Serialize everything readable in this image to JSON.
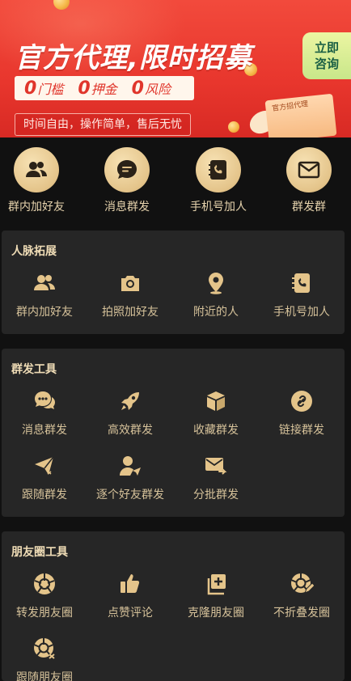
{
  "banner": {
    "title": "官方代理,限时招募",
    "tags": [
      {
        "num": "0",
        "text": "门槛"
      },
      {
        "num": "0",
        "text": "押金"
      },
      {
        "num": "0",
        "text": "风险"
      }
    ],
    "slogan": "时间自由，操作简单，售后无忧",
    "consult_line1": "立即",
    "consult_line2": "咨询",
    "box_label": "官方招代理"
  },
  "quick": [
    {
      "label": "群内加好友",
      "icon": "group-users-icon"
    },
    {
      "label": "消息群发",
      "icon": "message-bubble-icon"
    },
    {
      "label": "手机号加人",
      "icon": "phone-book-icon"
    },
    {
      "label": "群发群",
      "icon": "envelope-icon"
    }
  ],
  "sections": {
    "network": {
      "title": "人脉拓展",
      "items": [
        {
          "label": "群内加好友",
          "icon": "group-users-icon"
        },
        {
          "label": "拍照加好友",
          "icon": "camera-icon"
        },
        {
          "label": "附近的人",
          "icon": "location-pin-icon"
        },
        {
          "label": "手机号加人",
          "icon": "phone-book-icon"
        }
      ]
    },
    "broadcast": {
      "title": "群发工具",
      "items": [
        {
          "label": "消息群发",
          "icon": "chat-bubbles-icon"
        },
        {
          "label": "高效群发",
          "icon": "rocket-icon"
        },
        {
          "label": "收藏群发",
          "icon": "cube-icon"
        },
        {
          "label": "链接群发",
          "icon": "link-icon"
        },
        {
          "label": "跟随群发",
          "icon": "paper-plane-icon"
        },
        {
          "label": "逐个好友群发",
          "icon": "user-send-icon"
        },
        {
          "label": "分批群发",
          "icon": "mail-forward-icon"
        }
      ]
    },
    "moments": {
      "title": "朋友圈工具",
      "items": [
        {
          "label": "转发朋友圈",
          "icon": "aperture-icon"
        },
        {
          "label": "点赞评论",
          "icon": "thumbs-up-icon"
        },
        {
          "label": "克隆朋友圈",
          "icon": "clone-icon"
        },
        {
          "label": "不折叠发圈",
          "icon": "aperture-edit-icon"
        },
        {
          "label": "跟随朋友圈",
          "icon": "aperture-shuffle-icon"
        }
      ]
    }
  },
  "colors": {
    "banner_red": "#e8362d",
    "gold": "#e4c48a",
    "label": "#d6c29a",
    "panel": "#262626",
    "background": "#111111"
  }
}
